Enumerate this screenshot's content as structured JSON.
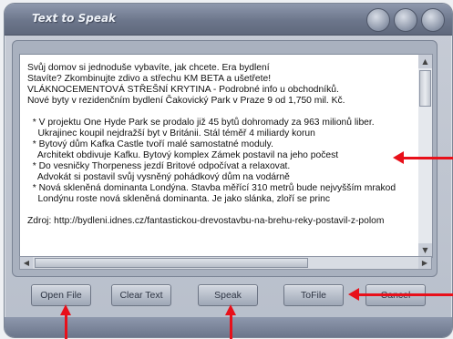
{
  "window": {
    "title": "Text to Speak"
  },
  "text_lines": [
    "Svůj domov si jednoduše vybavíte, jak chcete. Era bydlení",
    "Stavíte? Zkombinujte zdivo a střechu KM BETA a ušetřete!",
    "VLÁKNOCEMENTOVÁ STŘEŠNÍ KRYTINA - Podrobné info u obchodníků.",
    "Nové byty v rezidenčním bydlení Čakovický Park v Praze 9 od 1,750 mil. Kč.",
    "",
    "  * V projektu One Hyde Park se prodalo již 45 bytů dohromady za 963 milionů liber.",
    "    Ukrajinec koupil nejdražší byt v Británii. Stál téměř 4 miliardy korun",
    "  * Bytový dům Kafka Castle tvoří malé samostatné moduly.",
    "    Architekt obdivuje Kafku. Bytový komplex Zámek postavil na jeho počest",
    "  * Do vesničky Thorpeness jezdí Britové odpočívat a relaxovat.",
    "    Advokát si postavil svůj vysněný pohádkový dům na vodárně",
    "  * Nová skleněná dominanta Londýna. Stavba měřící 310 metrů bude nejvyšším mrakod",
    "    Londýnu roste nová skleněná dominanta. Je jako slánka, zloří se princ",
    "",
    "Zdroj: http://bydleni.idnes.cz/fantastickou-drevostavbu-na-brehu-reky-postavil-z-polom"
  ],
  "buttons": {
    "open_file": "Open File",
    "clear_text": "Clear Text",
    "speak": "Speak",
    "to_file": "ToFile",
    "cancel": "Cancel"
  },
  "icons": {
    "scroll_up": "▲",
    "scroll_down": "▼",
    "scroll_left": "◀",
    "scroll_right": "▶"
  },
  "colors": {
    "annotation_red": "#e8101a"
  }
}
